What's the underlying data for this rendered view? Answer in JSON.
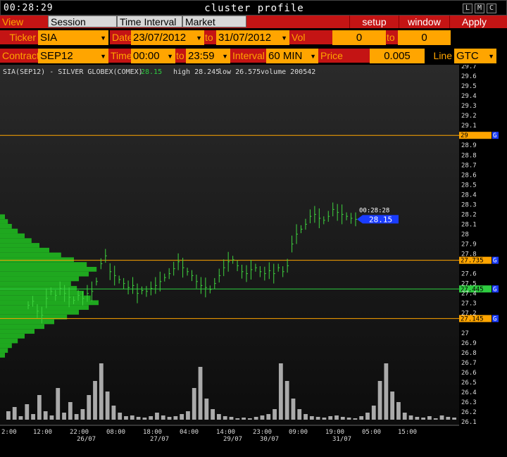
{
  "window": {
    "clock": "00:28:29",
    "title": "cluster profile",
    "buttons": [
      "L",
      "M",
      "C"
    ]
  },
  "toolbar": {
    "view_dom": "View DOM",
    "session_hours": "Session Hours",
    "time_interval": "Time Interval",
    "market_watch": "Market Watch",
    "setup": "setup",
    "window": "window",
    "apply": "Apply"
  },
  "params": {
    "ticker_label": "Ticker",
    "ticker": "SIA",
    "date_label": "Date",
    "date_from": "23/07/2012",
    "date_to_label": "to",
    "date_to": "31/07/2012",
    "vol_range_label": "Vol range",
    "vol_from": "0",
    "vol_to_label": "to",
    "vol_to": "0",
    "contract_label": "Contract",
    "contract": "SEP12",
    "time_label": "Time",
    "time_from": "00:00",
    "time_to_label": "to",
    "time_to": "23:59",
    "interval_label": "Interval",
    "interval": "60 MIN",
    "price_scale_label": "Price Scale",
    "price_scale": "0.005",
    "line_label": "Line",
    "line": "GTC"
  },
  "colors": {
    "accent_red": "#c41414",
    "field_orange": "#ffa500",
    "price_green": "#2ecc40",
    "marker_blue": "#1a3cff"
  },
  "chart_data": {
    "type": "line",
    "header": {
      "symbol": "SIA(SEP12) - SILVER GLOBEX(COMEX)",
      "last": "28.15",
      "high": "high 28.245",
      "low": "low 26.575",
      "volume": "volume 200542"
    },
    "price_axis": {
      "ylim": [
        26.1,
        29.7
      ],
      "labels": [
        "29.7",
        "29.6",
        "29.5",
        "29.4",
        "29.3",
        "29.2",
        "29.1",
        "28.9",
        "28.8",
        "28.7",
        "28.6",
        "28.5",
        "28.4",
        "28.3",
        "28.2",
        "28.1",
        "28",
        "27.9",
        "27.8",
        "27.6",
        "27.5",
        "27.4",
        "27.3",
        "27.2",
        "27",
        "26.9",
        "26.8",
        "26.7",
        "26.6",
        "26.5",
        "26.4",
        "26.3",
        "26.2",
        "26.1"
      ],
      "label_values": [
        29.7,
        29.6,
        29.5,
        29.4,
        29.3,
        29.2,
        29.1,
        28.9,
        28.8,
        28.7,
        28.6,
        28.5,
        28.4,
        28.3,
        28.2,
        28.1,
        28.0,
        27.9,
        27.8,
        27.6,
        27.5,
        27.4,
        27.3,
        27.2,
        27.0,
        26.9,
        26.8,
        26.7,
        26.6,
        26.5,
        26.4,
        26.3,
        26.2,
        26.1
      ]
    },
    "time_axis": {
      "hours": [
        "2:00",
        "12:00",
        "22:00",
        "08:00",
        "18:00",
        "04:00",
        "14:00",
        "23:00",
        "09:00",
        "19:00",
        "05:00",
        "15:00"
      ],
      "dates": [
        {
          "label": "26/07",
          "index": 2
        },
        {
          "label": "27/07",
          "index": 4
        },
        {
          "label": "29/07",
          "index": 6
        },
        {
          "label": "30/07",
          "index": 7
        },
        {
          "label": "31/07",
          "index": 9
        }
      ]
    },
    "levels": [
      {
        "price": 29.0,
        "label": "29",
        "flag": "G",
        "color": "#ffa500"
      },
      {
        "price": 27.735,
        "label": "27.735",
        "flag": "G",
        "color": "#ffa500"
      },
      {
        "price": 27.445,
        "label": "27.445",
        "flag": "G",
        "color": "#2ecc40"
      },
      {
        "price": 27.145,
        "label": "27.145",
        "flag": "G",
        "color": "#ffa500"
      }
    ],
    "last_marker": {
      "time": "00:28:28",
      "price": 28.15,
      "label": "28.15"
    },
    "prices": [
      27.28,
      27.32,
      27.22,
      27.18,
      27.35,
      27.42,
      27.38,
      27.45,
      27.4,
      27.36,
      27.33,
      27.38,
      27.35,
      27.4,
      27.42,
      27.52,
      27.7,
      27.78,
      27.62,
      27.58,
      27.54,
      27.5,
      27.46,
      27.48,
      27.4,
      27.43,
      27.42,
      27.45,
      27.48,
      27.52,
      27.56,
      27.6,
      27.65,
      27.72,
      27.66,
      27.62,
      27.58,
      27.52,
      27.48,
      27.46,
      27.44,
      27.5,
      27.58,
      27.66,
      27.72,
      27.74,
      27.68,
      27.62,
      27.6,
      27.64,
      27.66,
      27.62,
      27.6,
      27.63,
      27.6,
      27.66,
      27.62,
      27.68,
      27.9,
      28.0,
      28.05,
      28.1,
      28.18,
      28.2,
      28.16,
      28.14,
      28.18,
      28.25,
      28.22,
      28.2,
      28.18,
      28.16,
      28.15
    ],
    "volumes": [
      0.12,
      0.18,
      0.05,
      0.22,
      0.08,
      0.35,
      0.12,
      0.06,
      0.45,
      0.1,
      0.25,
      0.08,
      0.15,
      0.35,
      0.55,
      0.8,
      0.4,
      0.2,
      0.1,
      0.05,
      0.06,
      0.04,
      0.03,
      0.05,
      0.1,
      0.06,
      0.04,
      0.05,
      0.08,
      0.12,
      0.45,
      0.75,
      0.3,
      0.15,
      0.08,
      0.05,
      0.04,
      0.02,
      0.03,
      0.02,
      0.04,
      0.06,
      0.08,
      0.15,
      0.8,
      0.55,
      0.3,
      0.15,
      0.08,
      0.05,
      0.04,
      0.03,
      0.05,
      0.06,
      0.04,
      0.03,
      0.02,
      0.05,
      0.1,
      0.2,
      0.55,
      0.8,
      0.4,
      0.25,
      0.1,
      0.06,
      0.04,
      0.03,
      0.05,
      0.02,
      0.06,
      0.04,
      0.03
    ],
    "profile": [
      0.05,
      0.08,
      0.12,
      0.18,
      0.25,
      0.35,
      0.45,
      0.55,
      0.68,
      0.8,
      0.9,
      1.0,
      0.92,
      0.85,
      0.78,
      0.72,
      0.8,
      0.9,
      0.98,
      0.88,
      0.75,
      0.62,
      0.5,
      0.4,
      0.32,
      0.25,
      0.18,
      0.12,
      0.08,
      0.05
    ],
    "profile_range": [
      26.75,
      28.2
    ]
  }
}
